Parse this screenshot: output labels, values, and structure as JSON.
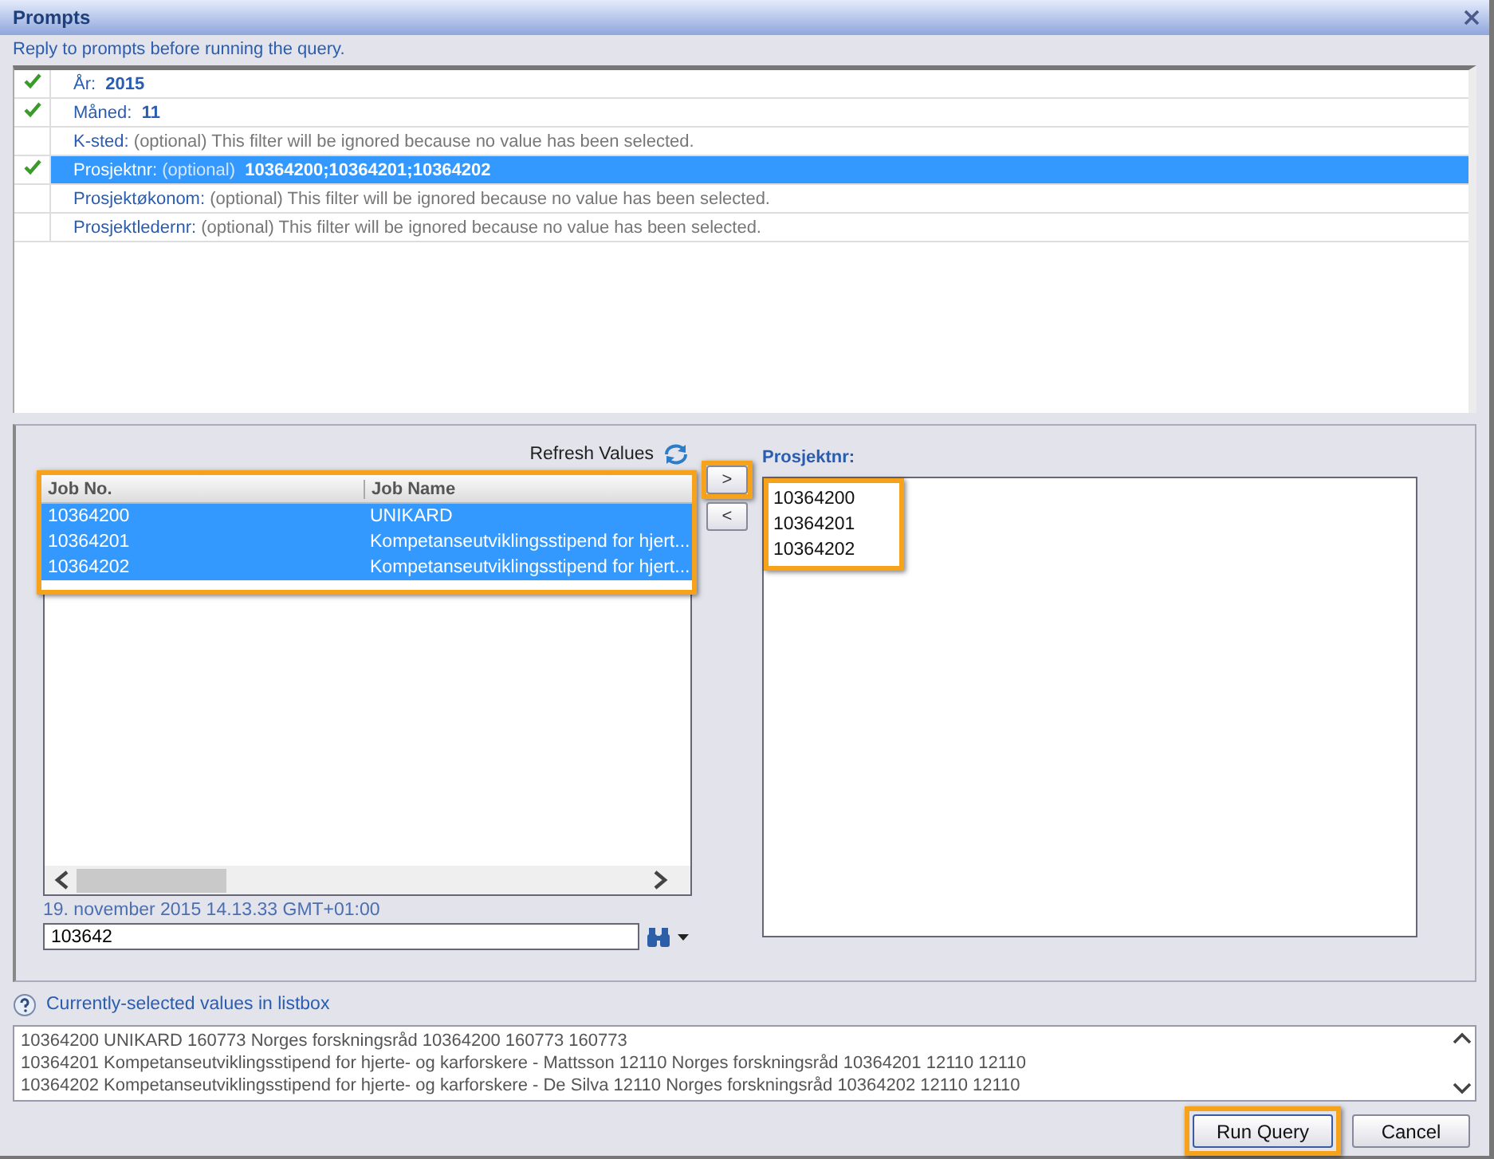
{
  "window": {
    "title": "Prompts",
    "instruction": "Reply to prompts before running the query."
  },
  "prompts": [
    {
      "label": "År:",
      "value": "2015",
      "answered": true,
      "selected": false
    },
    {
      "label": "Måned:",
      "value": "11",
      "answered": true,
      "selected": false
    },
    {
      "label": "K-sted:",
      "note": "(optional) This filter will be ignored because no value has been selected.",
      "answered": false,
      "selected": false
    },
    {
      "label": "Prosjektnr:",
      "note": "(optional)",
      "value": "10364200;10364201;10364202",
      "answered": true,
      "selected": true
    },
    {
      "label": "Prosjektøkonom:",
      "note": "(optional) This filter will be ignored because no value has been selected.",
      "answered": false,
      "selected": false
    },
    {
      "label": "Prosjektledernr:",
      "note": "(optional) This filter will be ignored because no value has been selected.",
      "answered": false,
      "selected": false
    }
  ],
  "picker": {
    "refresh_label": "Refresh Values",
    "columns": [
      "Job No.",
      "Job Name"
    ],
    "list_highlighted": true,
    "rows": [
      {
        "cells": [
          "10364200",
          "UNIKARD"
        ],
        "selected": true
      },
      {
        "cells": [
          "10364201",
          "Kompetanseutviklingsstipend for hjert..."
        ],
        "selected": true
      },
      {
        "cells": [
          "10364202",
          "Kompetanseutviklingsstipend for hjert..."
        ],
        "selected": true
      }
    ],
    "timestamp": "19. november 2015 14.13.33 GMT+01:00",
    "search_value": "103642",
    "move_buttons": [
      {
        "label": ">",
        "highlighted": true
      },
      {
        "label": "<",
        "highlighted": false
      }
    ],
    "selected_title": "Prosjektnr:",
    "selected_highlighted": true,
    "selected_values": [
      "10364200",
      "10364201",
      "10364202"
    ]
  },
  "details": {
    "title": "Currently-selected values in listbox",
    "lines": [
      "10364200 UNIKARD 160773 Norges forskningsråd 10364200 160773 160773",
      "10364201 Kompetanseutviklingsstipend for hjerte- og karforskere - Mattsson 12110 Norges forskningsråd 10364201 12110 12110",
      "10364202 Kompetanseutviklingsstipend for hjerte- og karforskere - De Silva 12110 Norges forskningsråd 10364202 12110 12110"
    ]
  },
  "buttons": [
    {
      "label": "Run Query",
      "highlighted": true
    },
    {
      "label": "Cancel",
      "highlighted": false
    }
  ]
}
